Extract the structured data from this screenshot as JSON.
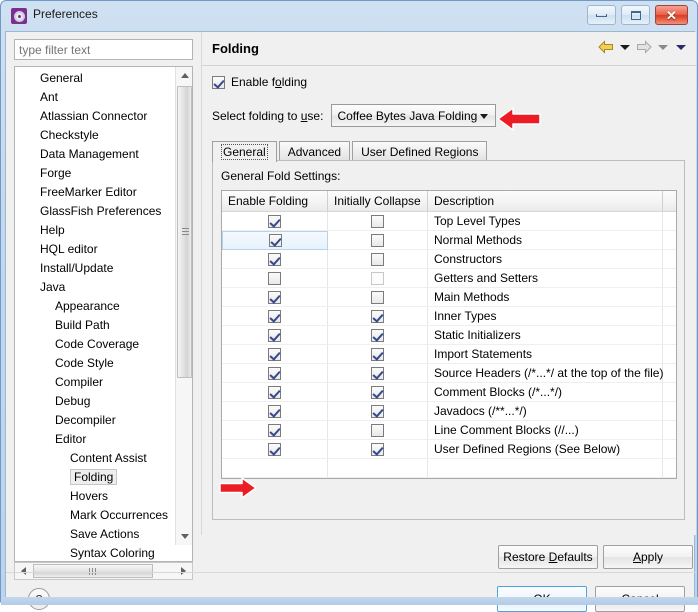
{
  "window": {
    "title": "Preferences",
    "icon": "preferences-gear-icon",
    "buttons": {
      "minimize": "minimize-icon",
      "maximize": "maximize-icon",
      "close": "✕"
    }
  },
  "sidebar": {
    "filter": {
      "value": "",
      "placeholder": "type filter text"
    },
    "items": [
      {
        "label": "General",
        "level": 0,
        "selected": false
      },
      {
        "label": "Ant",
        "level": 0,
        "selected": false
      },
      {
        "label": "Atlassian Connector",
        "level": 0,
        "selected": false
      },
      {
        "label": "Checkstyle",
        "level": 0,
        "selected": false
      },
      {
        "label": "Data Management",
        "level": 0,
        "selected": false
      },
      {
        "label": "Forge",
        "level": 0,
        "selected": false
      },
      {
        "label": "FreeMarker Editor",
        "level": 0,
        "selected": false
      },
      {
        "label": "GlassFish Preferences",
        "level": 0,
        "selected": false
      },
      {
        "label": "Help",
        "level": 0,
        "selected": false
      },
      {
        "label": "HQL editor",
        "level": 0,
        "selected": false
      },
      {
        "label": "Install/Update",
        "level": 0,
        "selected": false
      },
      {
        "label": "Java",
        "level": 0,
        "selected": false
      },
      {
        "label": "Appearance",
        "level": 1,
        "selected": false
      },
      {
        "label": "Build Path",
        "level": 1,
        "selected": false
      },
      {
        "label": "Code Coverage",
        "level": 1,
        "selected": false
      },
      {
        "label": "Code Style",
        "level": 1,
        "selected": false
      },
      {
        "label": "Compiler",
        "level": 1,
        "selected": false
      },
      {
        "label": "Debug",
        "level": 1,
        "selected": false
      },
      {
        "label": "Decompiler",
        "level": 1,
        "selected": false
      },
      {
        "label": "Editor",
        "level": 1,
        "selected": false
      },
      {
        "label": "Content Assist",
        "level": 2,
        "selected": false
      },
      {
        "label": "Folding",
        "level": 2,
        "selected": true
      },
      {
        "label": "Hovers",
        "level": 2,
        "selected": false
      },
      {
        "label": "Mark Occurrences",
        "level": 2,
        "selected": false
      },
      {
        "label": "Save Actions",
        "level": 2,
        "selected": false
      },
      {
        "label": "Syntax Coloring",
        "level": 2,
        "selected": false
      }
    ]
  },
  "main": {
    "title": "Folding",
    "enable_folding": {
      "label_pre": "Enable f",
      "label_accel": "o",
      "label_post": "lding",
      "checked": true
    },
    "select_folding": {
      "label_pre": "Select folding to ",
      "label_accel": "u",
      "label_post": "se:",
      "value": "Coffee Bytes Java Folding"
    },
    "tabs": [
      {
        "label": "General",
        "active": true
      },
      {
        "label": "Advanced",
        "active": false
      },
      {
        "label": "User Defined Regions",
        "active": false
      }
    ],
    "group_label": "General Fold Settings:",
    "table": {
      "columns": [
        "Enable Folding",
        "Initially Collapse",
        "Description",
        ""
      ],
      "rows": [
        {
          "enable": "checked",
          "collapse": "unchecked",
          "description": "Top Level Types",
          "selected": false,
          "arrow": false
        },
        {
          "enable": "checked",
          "collapse": "unchecked",
          "description": "Normal Methods",
          "selected": true,
          "arrow": false
        },
        {
          "enable": "checked",
          "collapse": "unchecked",
          "description": "Constructors",
          "selected": false,
          "arrow": false
        },
        {
          "enable": "unchecked",
          "collapse": "disabled",
          "description": "Getters and Setters",
          "selected": false,
          "arrow": false
        },
        {
          "enable": "checked",
          "collapse": "unchecked",
          "description": "Main Methods",
          "selected": false,
          "arrow": false
        },
        {
          "enable": "checked",
          "collapse": "checked",
          "description": "Inner Types",
          "selected": false,
          "arrow": false
        },
        {
          "enable": "checked",
          "collapse": "checked",
          "description": "Static Initializers",
          "selected": false,
          "arrow": false
        },
        {
          "enable": "checked",
          "collapse": "checked",
          "description": "Import Statements",
          "selected": false,
          "arrow": false
        },
        {
          "enable": "checked",
          "collapse": "checked",
          "description": "Source Headers (/*...*/ at the top of the file)",
          "selected": false,
          "arrow": false
        },
        {
          "enable": "checked",
          "collapse": "checked",
          "description": "Comment Blocks (/*...*/)",
          "selected": false,
          "arrow": false
        },
        {
          "enable": "checked",
          "collapse": "checked",
          "description": "Javadocs (/**...*/)",
          "selected": false,
          "arrow": false
        },
        {
          "enable": "checked",
          "collapse": "unchecked",
          "description": "Line Comment Blocks (//...)",
          "selected": false,
          "arrow": false
        },
        {
          "enable": "checked",
          "collapse": "checked",
          "description": "User Defined Regions (See Below)",
          "selected": false,
          "arrow": true
        },
        {
          "enable": "none",
          "collapse": "none",
          "description": "",
          "selected": false,
          "arrow": false
        }
      ]
    },
    "nav": {
      "back": "back-arrow-icon",
      "back_menu": "back-dropdown-icon",
      "forward": "forward-arrow-icon",
      "forward_menu": "forward-dropdown-icon",
      "menu": "view-menu-icon"
    }
  },
  "footer": {
    "restore_defaults_pre": "Restore ",
    "restore_defaults_accel": "D",
    "restore_defaults_post": "efaults",
    "apply_accel": "A",
    "apply_post": "pply",
    "help": "?",
    "ok": "OK",
    "cancel": "Cancel"
  },
  "annotations": {
    "arrow_combo": "red-left-arrow",
    "arrow_table_row": "red-right-arrow",
    "color": "#ec1c24"
  }
}
